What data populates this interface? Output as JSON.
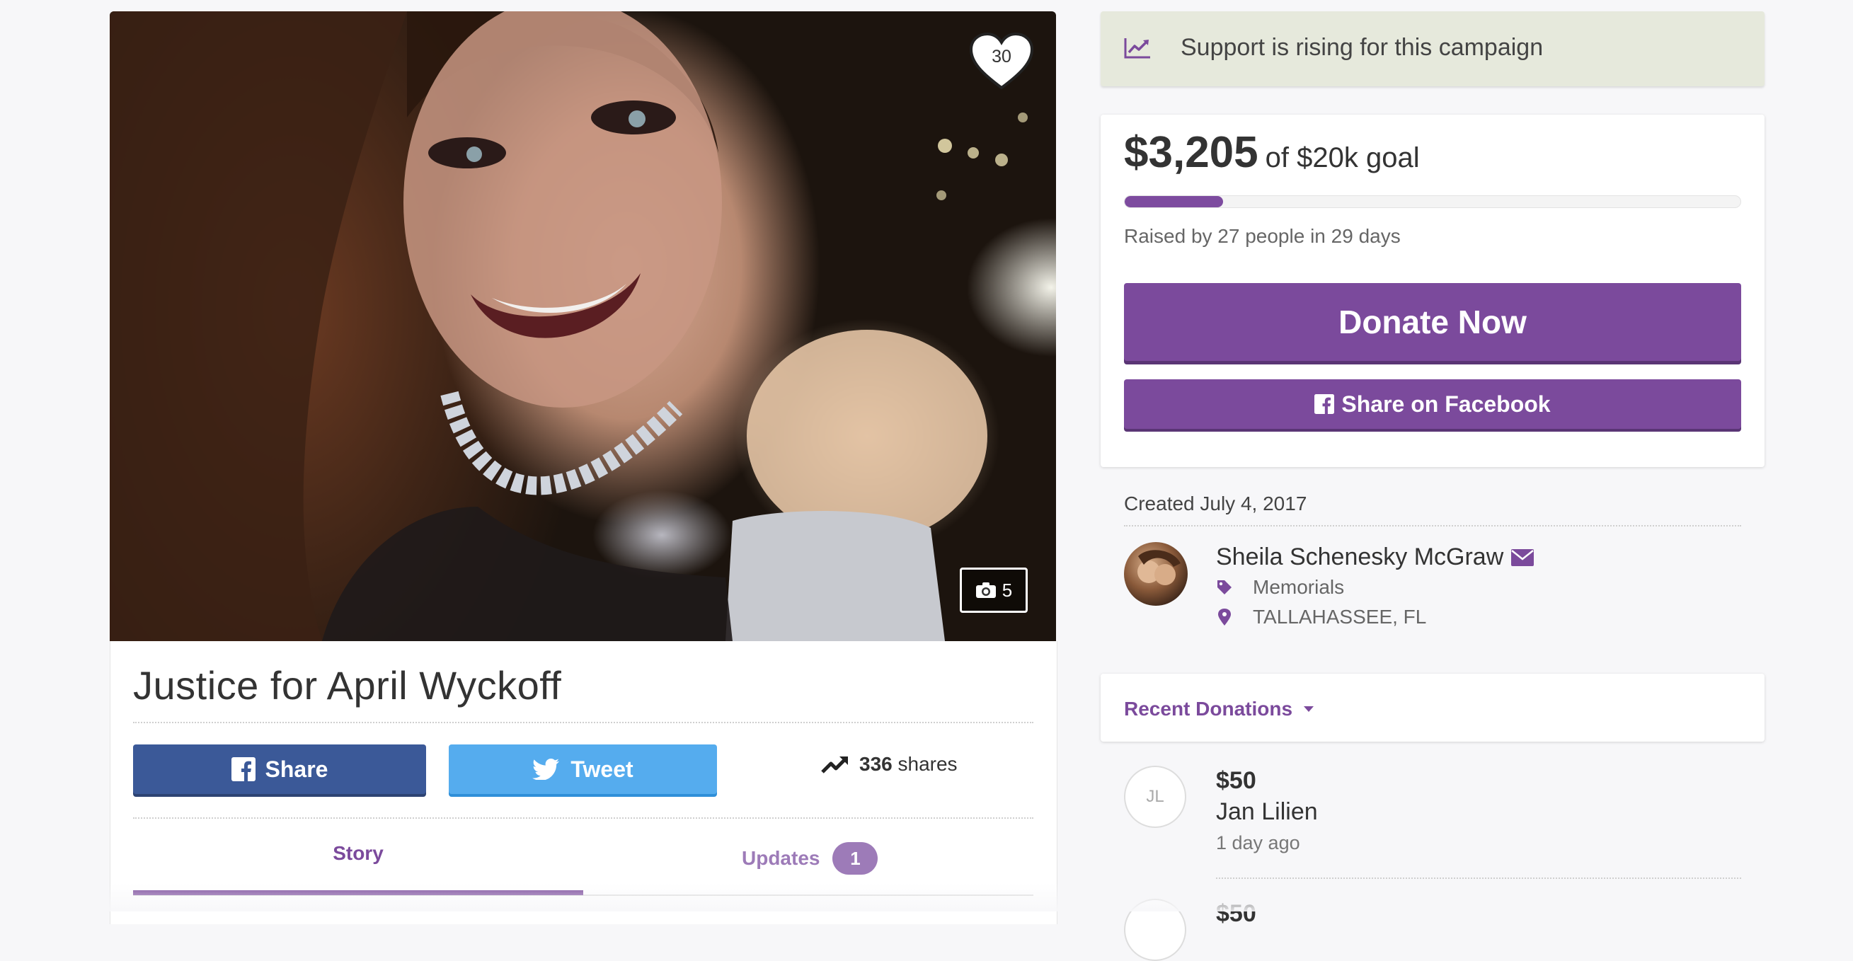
{
  "campaign": {
    "title": "Justice for April Wyckoff",
    "heart_count": "30",
    "photo_count": "5"
  },
  "social": {
    "share_label": "Share",
    "tweet_label": "Tweet",
    "shares_count": "336",
    "shares_label": "shares"
  },
  "tabs": {
    "story": "Story",
    "updates": "Updates",
    "updates_badge": "1"
  },
  "banner": {
    "text": "Support is rising for this campaign"
  },
  "progress": {
    "amount": "$3,205",
    "goal_text": "of $20k goal",
    "raised_fraction": 0.16,
    "raised_by": "Raised by 27 people in 29 days"
  },
  "actions": {
    "donate_label": "Donate Now",
    "facebook_label": "Share on Facebook"
  },
  "organizer": {
    "created": "Created July 4, 2017",
    "name": "Sheila Schenesky McGraw",
    "category": "Memorials",
    "location": "TALLAHASSEE, FL"
  },
  "donations": {
    "header": "Recent Donations",
    "items": [
      {
        "initials": "JL",
        "amount": "$50",
        "name": "Jan Lilien",
        "time": "1 day ago"
      },
      {
        "amount": "$50"
      }
    ]
  },
  "colors": {
    "brand_purple": "#7b4a9c",
    "facebook_blue": "#3b5998",
    "twitter_blue": "#55acee",
    "banner_bg": "#e6e9dc"
  },
  "icons": [
    "heart-icon",
    "camera-icon",
    "facebook-icon",
    "twitter-icon",
    "trending-icon",
    "envelope-icon",
    "tag-icon",
    "location-pin-icon",
    "caret-down-icon"
  ]
}
